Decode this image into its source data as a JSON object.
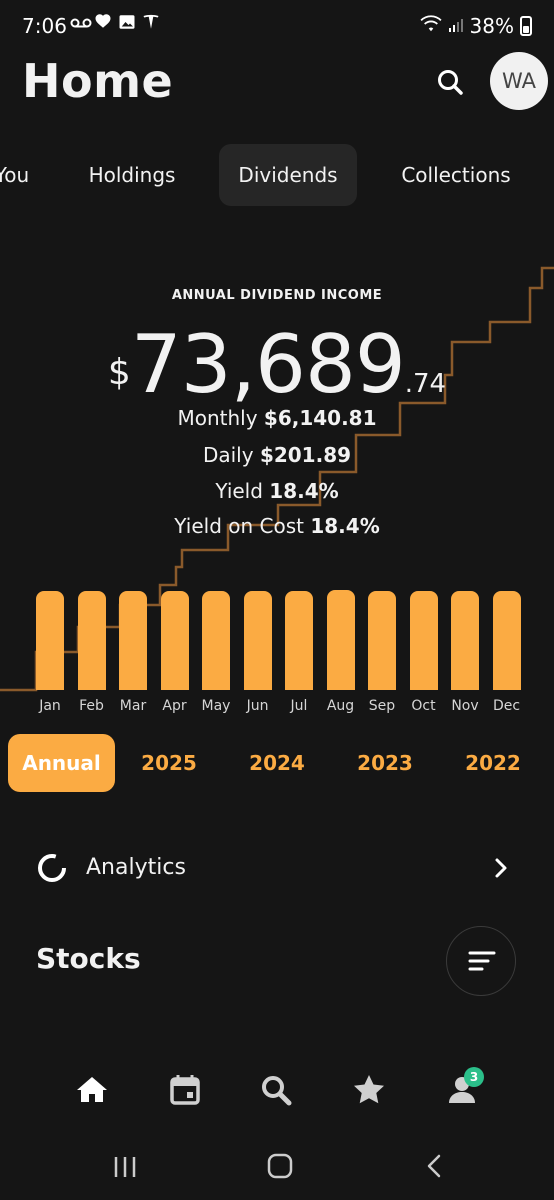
{
  "status_bar": {
    "time": "7:06",
    "battery": "38%"
  },
  "header": {
    "title": "Home",
    "avatar_initials": "WA"
  },
  "tabs": [
    {
      "label": "You",
      "active": false
    },
    {
      "label": "Holdings",
      "active": false
    },
    {
      "label": "Dividends",
      "active": true
    },
    {
      "label": "Collections",
      "active": false
    }
  ],
  "income": {
    "label": "ANNUAL DIVIDEND INCOME",
    "currency": "$",
    "whole": "73,689",
    "cents": ".74",
    "monthly_label": "Monthly",
    "monthly_value": "$6,140.81",
    "daily_label": "Daily",
    "daily_value": "$201.89",
    "yield_label": "Yield",
    "yield_value": "18.4%",
    "yoc_label": "Yield on Cost",
    "yoc_value": "18.4%"
  },
  "chart_data": {
    "type": "bar",
    "categories": [
      "Jan",
      "Feb",
      "Mar",
      "Apr",
      "May",
      "Jun",
      "Jul",
      "Aug",
      "Sep",
      "Oct",
      "Nov",
      "Dec"
    ],
    "values": [
      99,
      99,
      99,
      99,
      99,
      99,
      99,
      100,
      99,
      99,
      99,
      99
    ],
    "value_scale": "relative, no axis printed",
    "overlay_line": "cumulative step line (orange-brown)",
    "bar_color": "#fbab43"
  },
  "year_selector": [
    {
      "label": "Annual",
      "active": true
    },
    {
      "label": "2025",
      "active": false
    },
    {
      "label": "2024",
      "active": false
    },
    {
      "label": "2023",
      "active": false
    },
    {
      "label": "2022",
      "active": false
    }
  ],
  "analytics": {
    "label": "Analytics"
  },
  "stocks": {
    "title": "Stocks"
  },
  "bottom_nav": {
    "items": [
      "home-icon",
      "calendar-icon",
      "search-icon",
      "star-icon",
      "profile-icon"
    ],
    "profile_badge": "3"
  },
  "colors": {
    "accent": "#fbab43",
    "background": "#151515",
    "badge": "#2bbf8a"
  }
}
